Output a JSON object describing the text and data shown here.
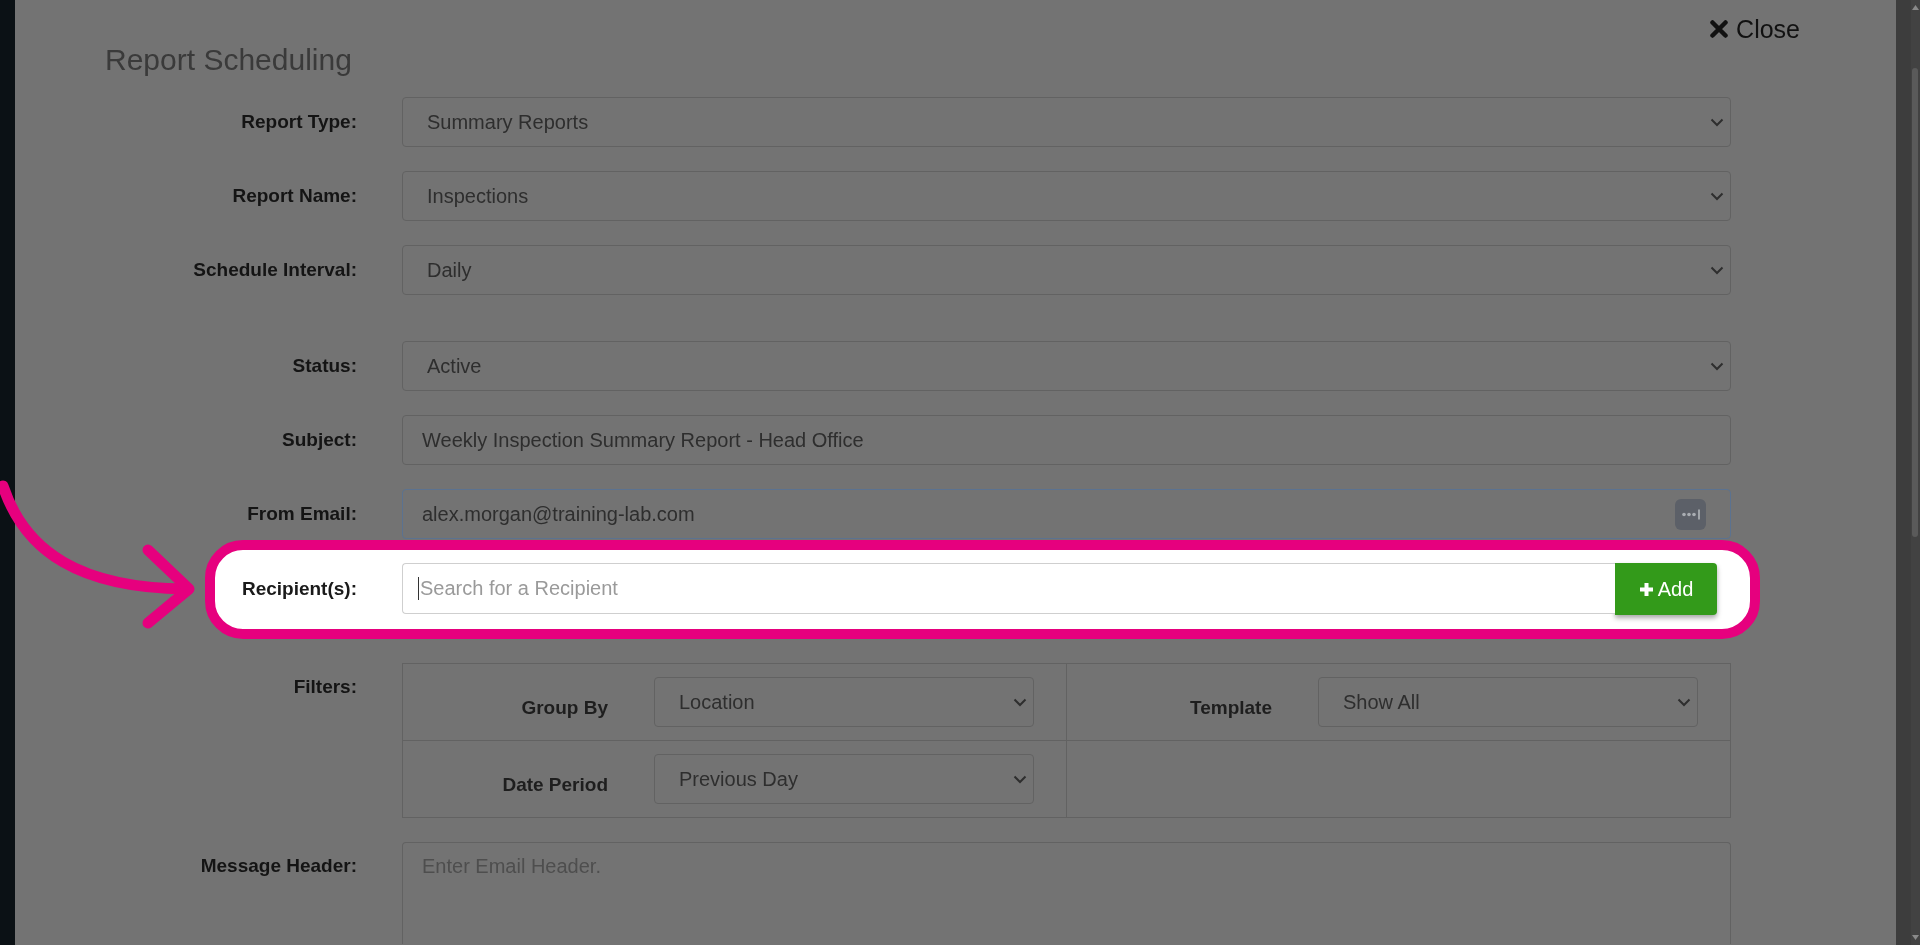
{
  "modal": {
    "title": "Report Scheduling",
    "close_label": "Close"
  },
  "fields": [
    {
      "kind": "select",
      "label": "Report Type:",
      "value": "Summary Reports",
      "focused": false
    },
    {
      "kind": "select",
      "label": "Report Name:",
      "value": "Inspections",
      "focused": false
    },
    {
      "kind": "select",
      "label": "Schedule Interval:",
      "value": "Daily",
      "focused": false
    },
    {
      "kind": "select",
      "label": "Status:",
      "value": "Active",
      "focused": false
    },
    {
      "kind": "text",
      "label": "Subject:",
      "value": "Weekly Inspection Summary Report - Head Office",
      "focused": false
    },
    {
      "kind": "email",
      "label": "From Email:",
      "value": "alex.morgan@training-lab.com",
      "focused": true
    }
  ],
  "recipients": {
    "label": "Recipient(s):",
    "placeholder": "Search for a Recipient",
    "button": "Add",
    "highlighted": true,
    "focused": true
  },
  "filters": {
    "label": "Filters:",
    "items": [
      {
        "label": "Group By",
        "value": "Location"
      },
      {
        "label": "Template",
        "value": "Show All"
      },
      {
        "label": "Date Period",
        "value": "Previous Day"
      }
    ]
  },
  "message_header": {
    "label": "Message Header:",
    "placeholder": "Enter Email Header."
  }
}
